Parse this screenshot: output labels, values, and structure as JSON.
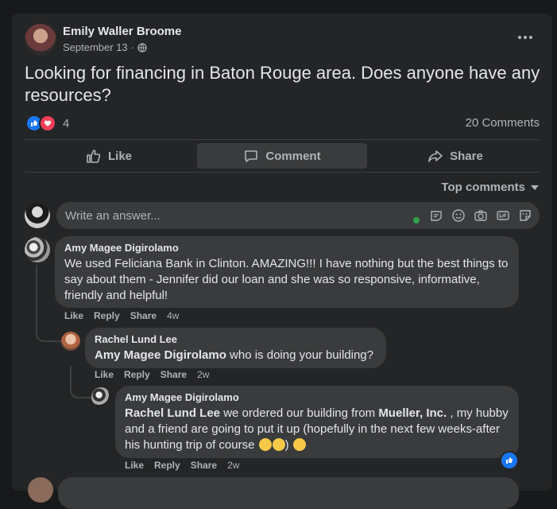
{
  "post": {
    "author": "Emily Waller Broome",
    "date": "September 13",
    "dot": "·",
    "text": "Looking for financing in Baton Rouge area. Does anyone have any resources?",
    "reaction_count": "4",
    "comments_count": "20 Comments"
  },
  "actions": {
    "like": "Like",
    "comment": "Comment",
    "share": "Share"
  },
  "sort_label": "Top comments",
  "composer": {
    "placeholder": "Write an answer..."
  },
  "comments": [
    {
      "author": "Amy Magee Digirolamo",
      "text": "We used Feliciana Bank in Clinton. AMAZING!!! I have nothing but the best things to say about them - Jennifer did our loan and she was so responsive, informative, friendly and helpful!",
      "like": "Like",
      "reply": "Reply",
      "share": "Share",
      "time": "4w"
    },
    {
      "author": "Rachel Lund Lee",
      "mention": "Amy Magee Digirolamo",
      "text": " who is doing your building?",
      "like": "Like",
      "reply": "Reply",
      "share": "Share",
      "time": "2w"
    },
    {
      "author": "Amy Magee Digirolamo",
      "mention": "Rachel Lund Lee",
      "text_a": " we ordered our building from ",
      "mention2": "Mueller, Inc.",
      "text_b": " , my hubby and a friend are going to put it up (hopefully in the next few weeks-after his hunting trip of course ",
      "text_c": ") ",
      "like": "Like",
      "reply": "Reply",
      "share": "Share",
      "time": "2w"
    }
  ],
  "colors": {
    "like_blue": "#1877f2",
    "love_red": "#f33e58",
    "online_green": "#31a24c"
  }
}
